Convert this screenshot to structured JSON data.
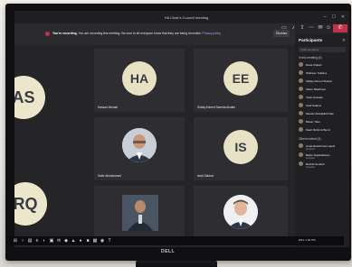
{
  "window": {
    "title": "HA Chair's Council meeting",
    "controls": [
      "–",
      "☐",
      "✕"
    ]
  },
  "recording_banner": {
    "title": "You're recording.",
    "message": "You are recording this meeting. Be sure to let everyone know that they are being recorded.",
    "link": "Privacy policy",
    "dismiss": "Dismiss"
  },
  "toolbar": {
    "icons": [
      "camera-icon",
      "mic-icon",
      "share-icon",
      "more-icon",
      "chat-icon",
      "people-icon"
    ],
    "icon_glyphs": [
      "▭",
      "♪",
      "⇪",
      "⋯",
      "✉",
      "☺"
    ],
    "leave": "✆"
  },
  "panel": {
    "header": "Participants",
    "close": "✕",
    "invite_placeholder": "Invite someone",
    "section_meeting": "In this meeting (9)",
    "section_others": "Others invited (3)",
    "participants": [
      "Rana Khaled",
      "Shaheen Sultana",
      "Siddiq Ahmed Sharuk",
      "Saher Mashhoor",
      "Yasin Hussain",
      "Israil Saidovi",
      "Moutaz Abdulallah Nas",
      "Bisser Yatur",
      "Nasir Mohd Al Bund"
    ],
    "others": [
      {
        "name": "Amal Abdelrhman Hashi",
        "status": "Accepted"
      },
      {
        "name": "Bader Alqahdarbani",
        "status": "Accepted"
      },
      {
        "name": "Rachid Soudah",
        "status": "Accepted"
      }
    ]
  },
  "tiles": [
    {
      "initials": "HA",
      "name": "Hassan Alsnadi",
      "type": "initials"
    },
    {
      "initials": "EE",
      "name": "Siddiq Ahmed Saeeda Alnatiri",
      "type": "initials"
    },
    {
      "initials": "",
      "name": "Sabir Abdulmaned",
      "type": "photo"
    },
    {
      "initials": "IS",
      "name": "Israil Saidovi",
      "type": "initials"
    },
    {
      "initials": "",
      "name": "Basser Yakus",
      "type": "photo"
    },
    {
      "initials": "",
      "name": "Moutaz Abdulnasser Daoud",
      "type": "photo"
    }
  ],
  "side_avatars": [
    {
      "initials": "AS"
    },
    {
      "initials": "RQ"
    }
  ],
  "taskbar": {
    "icons": [
      "⊞",
      "○",
      "▤",
      "e",
      "◐",
      "▣",
      "✉",
      "◆",
      "▲",
      "●",
      "■",
      "▦",
      "◉",
      "T"
    ],
    "tray": "ENG 1:02 PM"
  },
  "monitor": {
    "brand": "DELL"
  },
  "colors": {
    "teams_bg": "#252527",
    "avatar_bg": "#e8e2c5",
    "leave_red": "#c4314b",
    "accent": "#9ea7ff"
  }
}
